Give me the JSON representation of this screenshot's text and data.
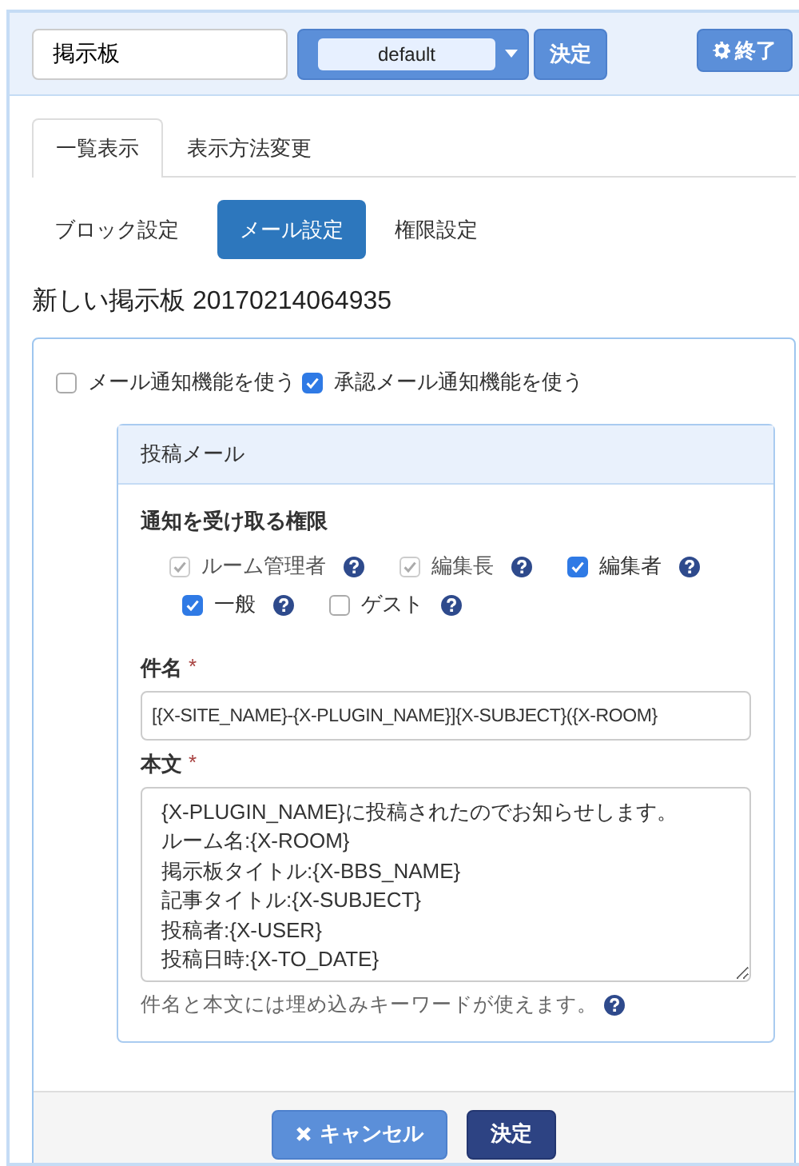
{
  "header": {
    "name_field": "掲示板",
    "frame_select": "default",
    "apply_button": "決定",
    "exit_button": "終了"
  },
  "tabs": [
    {
      "label": "一覧表示",
      "selected": true
    },
    {
      "label": "表示方法変更",
      "selected": false
    }
  ],
  "setting_tabs": [
    {
      "label": "ブロック設定",
      "selected": false
    },
    {
      "label": "メール設定",
      "selected": true
    },
    {
      "label": "権限設定",
      "selected": false
    }
  ],
  "title": "新しい掲示板 20170214064935",
  "notify_options": [
    {
      "label": "メール通知機能を使う",
      "checked": false
    },
    {
      "label": "承認メール通知機能を使う",
      "checked": true
    }
  ],
  "mail_panel": {
    "heading": "投稿メール",
    "permission_label": "通知を受け取る権限",
    "roles": [
      {
        "label": "ルーム管理者",
        "checked": true,
        "disabled": true
      },
      {
        "label": "編集長",
        "checked": true,
        "disabled": true
      },
      {
        "label": "編集者",
        "checked": true,
        "disabled": false
      },
      {
        "label": "一般",
        "checked": true,
        "disabled": false
      },
      {
        "label": "ゲスト",
        "checked": false,
        "disabled": false
      }
    ],
    "subject_label": "件名",
    "subject_required_mark": "*",
    "subject_value": "[{X-SITE_NAME}-{X-PLUGIN_NAME}]{X-SUBJECT}({X-ROOM}",
    "body_label": "本文",
    "body_required_mark": "*",
    "body_lines": [
      "{X-PLUGIN_NAME}に投稿されたのでお知らせします。",
      "ルーム名:{X-ROOM}",
      "掲示板タイトル:{X-BBS_NAME}",
      "記事タイトル:{X-SUBJECT}",
      "投稿者:{X-USER}",
      "投稿日時:{X-TO_DATE}"
    ],
    "hint": "件名と本文には埋め込みキーワードが使えます。"
  },
  "footer": {
    "cancel_button": "キャンセル",
    "submit_button": "決定"
  }
}
